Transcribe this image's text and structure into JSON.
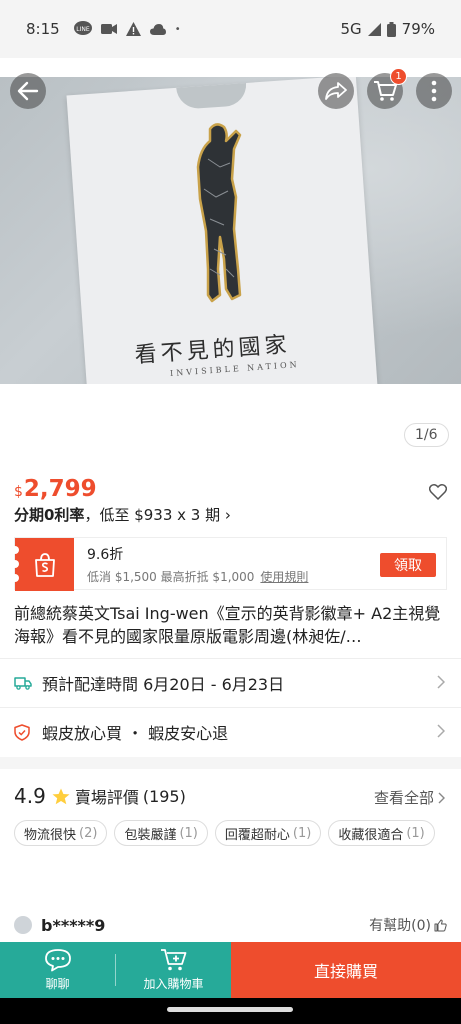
{
  "status": {
    "time": "8:15",
    "network": "5G",
    "battery": "79%"
  },
  "hero": {
    "card_cn": "看不見的國家",
    "card_en": "INVISIBLE NATION",
    "page_counter": "1/6",
    "cart_badge": "1"
  },
  "product": {
    "currency": "$",
    "price": "2,799",
    "installment_prefix": "分期0利率",
    "installment_rest": "，低至 $933 x 3 期 ›",
    "title": "前總統蔡英文Tsai Ing-wen《宣示的英背影徽章+ A2主視覺海報》看不見的國家限量原版電影周邊(林昶佐/…"
  },
  "coupon": {
    "rate": "9.6折",
    "desc": "低消 $1,500 最高折抵 $1,000",
    "rule": "使用規則",
    "claim": "領取"
  },
  "shipping": {
    "label": "預計配達時間 6月20日 - 6月23日"
  },
  "guarantee": {
    "label": "蝦皮放心買 ・ 蝦皮安心退"
  },
  "ratings": {
    "score": "4.9",
    "label": "賣場評價",
    "count": "(195)",
    "see_all": "查看全部",
    "tags": [
      {
        "label": "物流很快",
        "count": "(2)"
      },
      {
        "label": "包裝嚴謹",
        "count": "(1)"
      },
      {
        "label": "回覆超耐心",
        "count": "(1)"
      },
      {
        "label": "收藏很適合",
        "count": "(1)"
      }
    ],
    "first_review_user": "b*****9",
    "helpful": "有幫助(0)"
  },
  "bottom_bar": {
    "chat": "聊聊",
    "add_cart": "加入購物車",
    "buy_now": "直接購買"
  },
  "colors": {
    "brand": "#ee4d2d",
    "teal": "#26aa99"
  }
}
